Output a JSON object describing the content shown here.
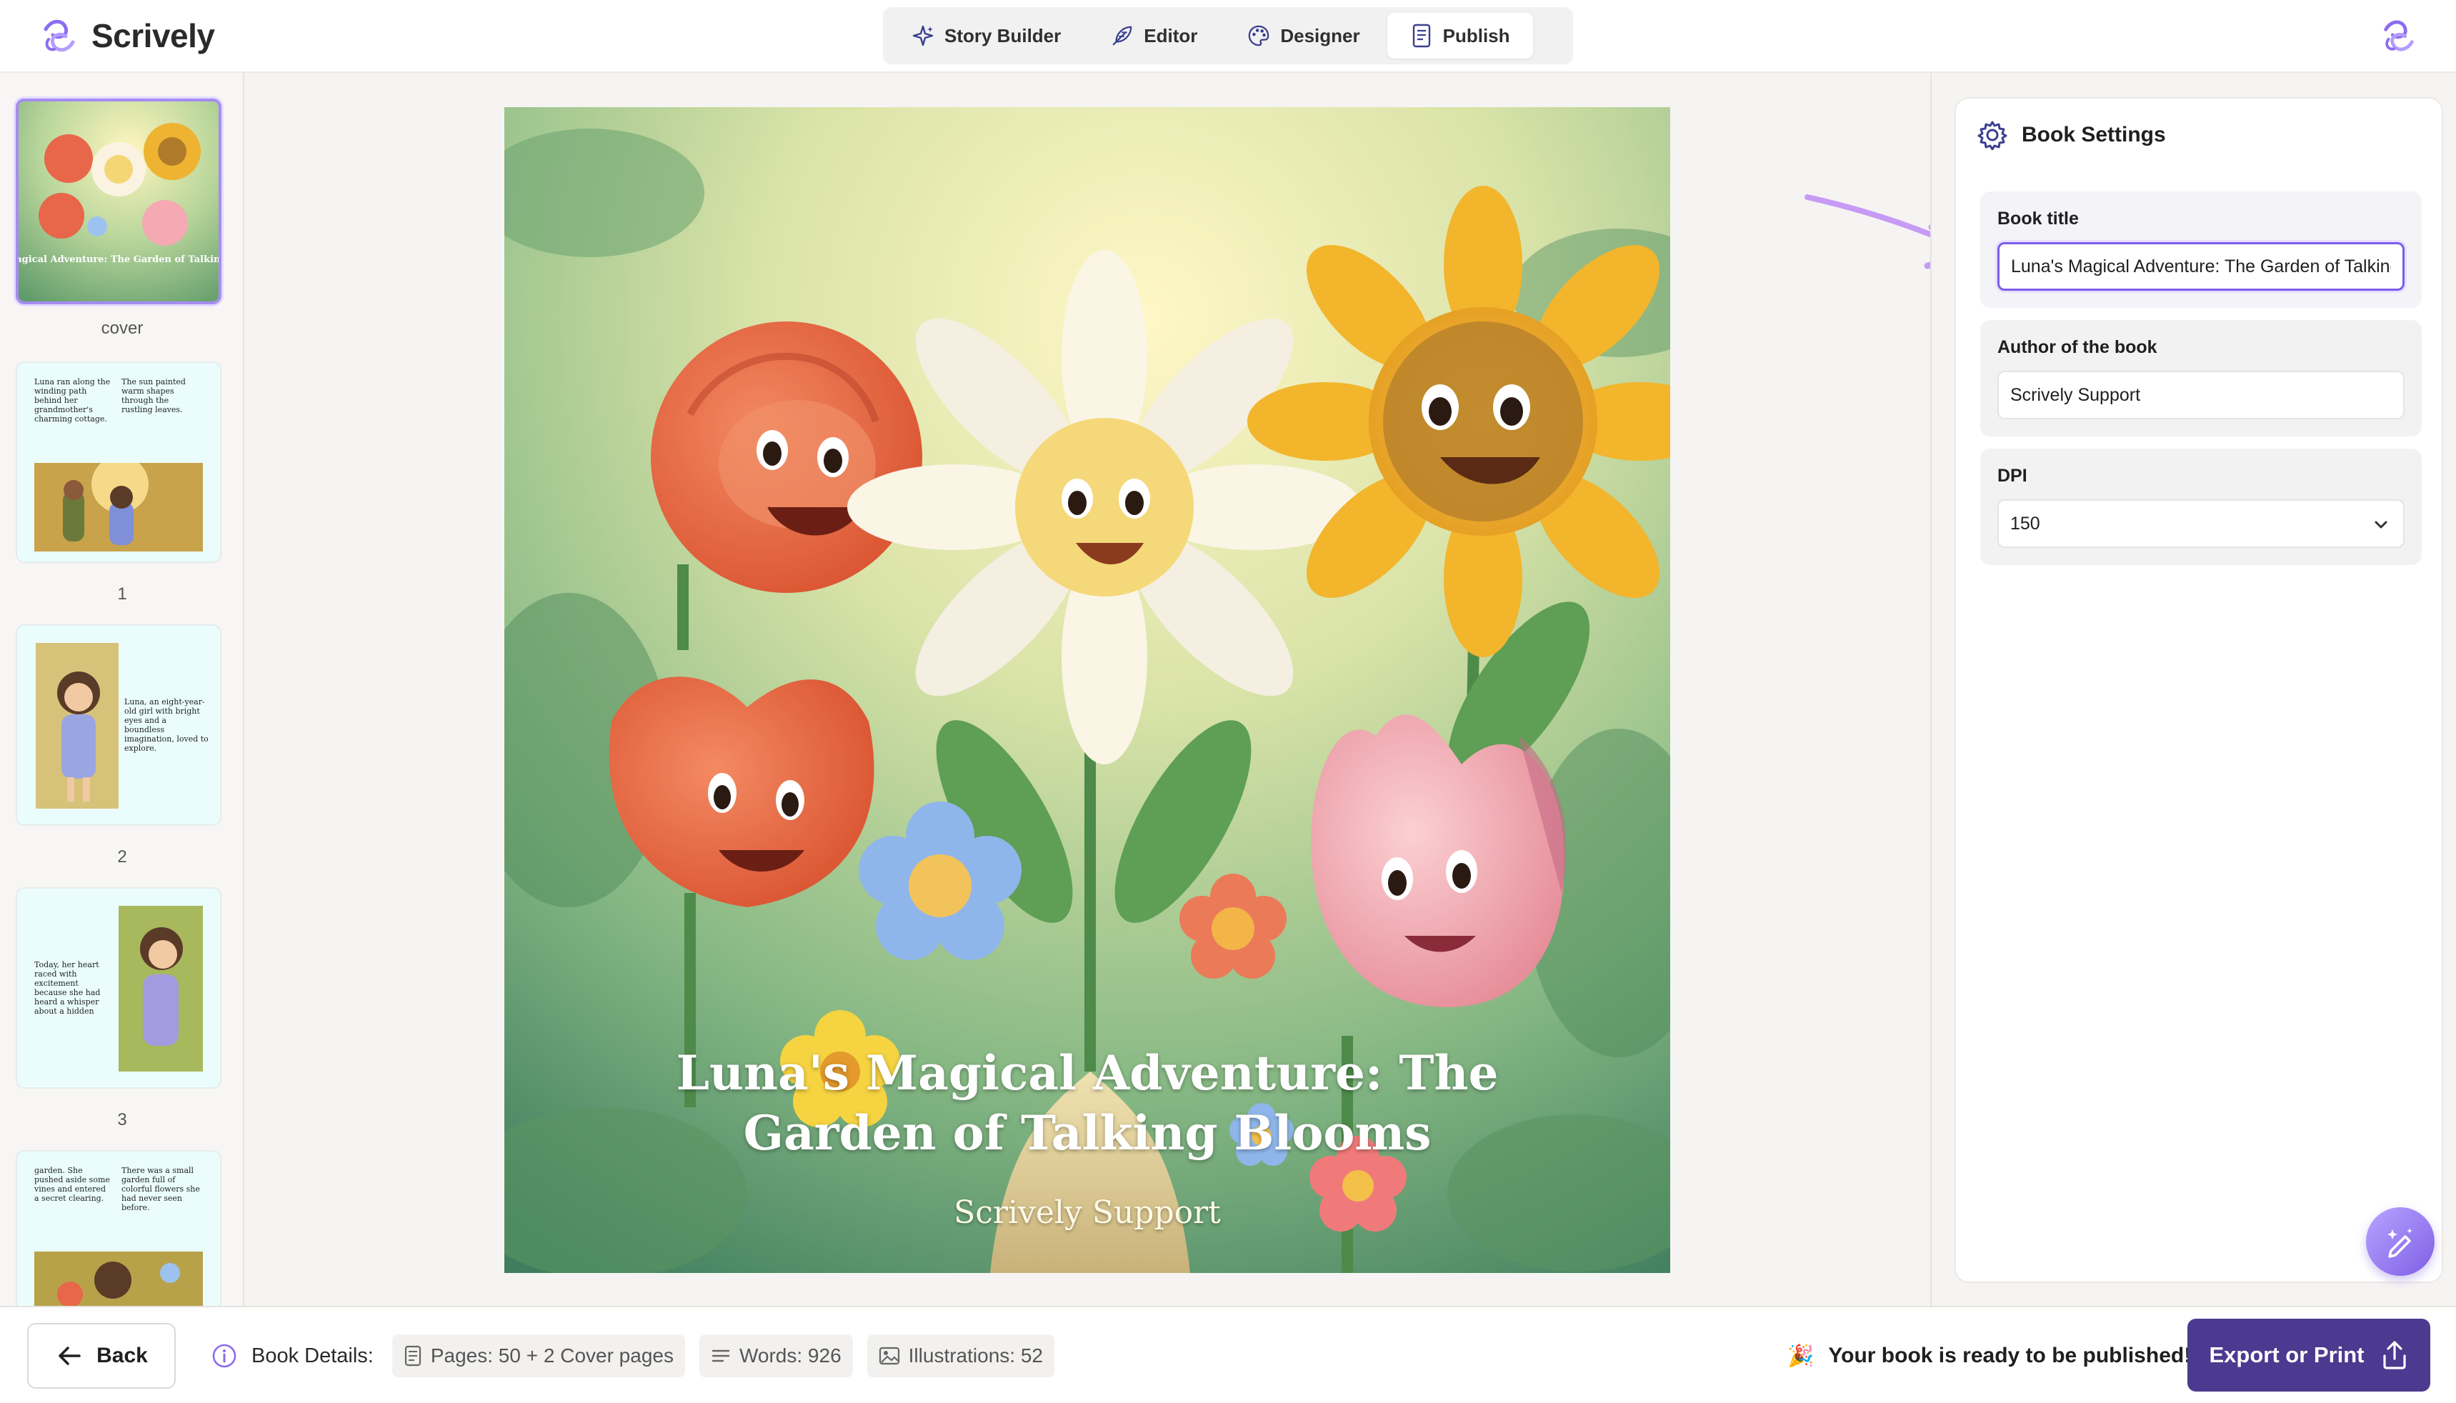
{
  "app": {
    "name": "Scrively"
  },
  "nav": {
    "tabs": [
      {
        "label": "Story Builder",
        "icon": "sparkle-icon"
      },
      {
        "label": "Editor",
        "icon": "feather-pen-icon"
      },
      {
        "label": "Designer",
        "icon": "palette-icon"
      },
      {
        "label": "Publish",
        "icon": "document-icon",
        "active": true
      }
    ]
  },
  "sidebar": {
    "pages": [
      {
        "label": "cover",
        "active": true
      },
      {
        "label": "1",
        "text_left": "Luna ran along the winding path behind her grandmother's charming cottage.",
        "text_right": "The sun painted warm shapes through the rustling leaves."
      },
      {
        "label": "2",
        "text": "Luna, an eight-year-old girl with bright eyes and a boundless imagination, loved to explore."
      },
      {
        "label": "3",
        "text": "Today, her heart raced with excitement because she had heard a whisper about a hidden"
      },
      {
        "label": "",
        "text_left": "garden. She pushed aside some vines and entered a secret clearing.",
        "text_right": "There was a small garden full of colorful flowers she had never seen before."
      }
    ]
  },
  "cover": {
    "title": "Luna's Magical Adventure: The Garden of Talking Blooms",
    "author": "Scrively Support",
    "thumb_title": "Luna's Magical Adventure: The Garden of Talking Blooms"
  },
  "settings": {
    "title": "Book Settings",
    "book_title_label": "Book title",
    "book_title_value": "Luna's Magical Adventure: The Garden of Talking Blooms",
    "author_label": "Author of the book",
    "author_value": "Scrively Support",
    "dpi_label": "DPI",
    "dpi_value": "150"
  },
  "bottom": {
    "back_label": "Back",
    "details_label": "Book Details:",
    "pages_chip": "Pages: 50 + 2 Cover pages",
    "words_chip": "Words: 926",
    "illustrations_chip": "Illustrations: 52",
    "ready_emoji": "🎉",
    "ready_text": "Your book is ready to be published!",
    "export_label": "Export or Print"
  },
  "colors": {
    "accent": "#7b5ce8",
    "export_button": "#4b3a8f",
    "page_bg": "#eafdfc"
  }
}
